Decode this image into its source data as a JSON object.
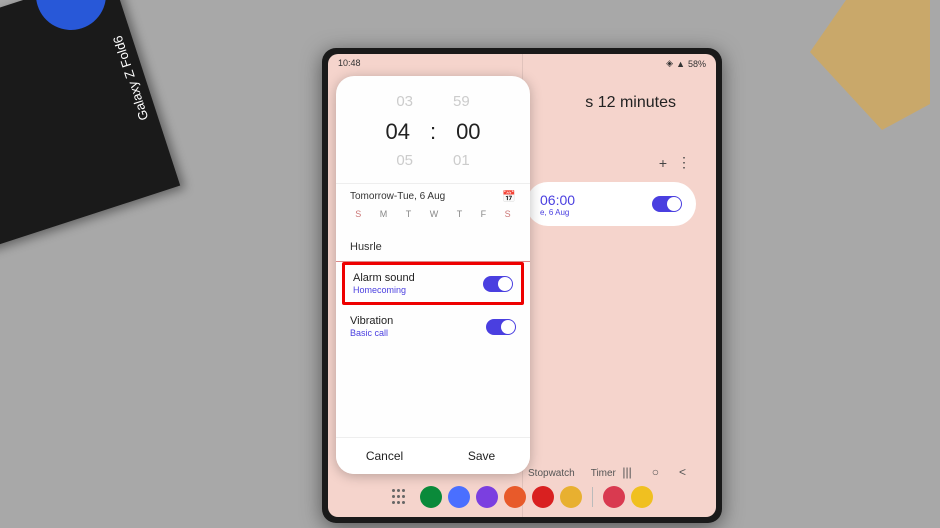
{
  "box_text": "Galaxy Z Fold6",
  "status": {
    "time": "10:48",
    "battery": "58%"
  },
  "subtitle": "s 12 minutes",
  "alarm_card": {
    "time": "06:00",
    "date": "e, 6 Aug"
  },
  "dialog": {
    "picker": {
      "prev_h": "03",
      "prev_m": "59",
      "h": "04",
      "m": "00",
      "next_h": "05",
      "next_m": "01"
    },
    "date": "Tomorrow-Tue, 6 Aug",
    "days": [
      "S",
      "M",
      "T",
      "W",
      "T",
      "F",
      "S"
    ],
    "name": "Husrle",
    "sound": {
      "title": "Alarm sound",
      "sub": "Homecoming"
    },
    "vib": {
      "title": "Vibration",
      "sub": "Basic call"
    },
    "cancel": "Cancel",
    "save": "Save"
  },
  "tabs": {
    "stopwatch": "Stopwatch",
    "timer": "Timer"
  },
  "dock_colors": [
    "#0a8a3a",
    "#4a6fff",
    "#7b3fe0",
    "#e85a2a",
    "#d92020",
    "#e8b030",
    "#d93a50",
    "#f0c020"
  ]
}
